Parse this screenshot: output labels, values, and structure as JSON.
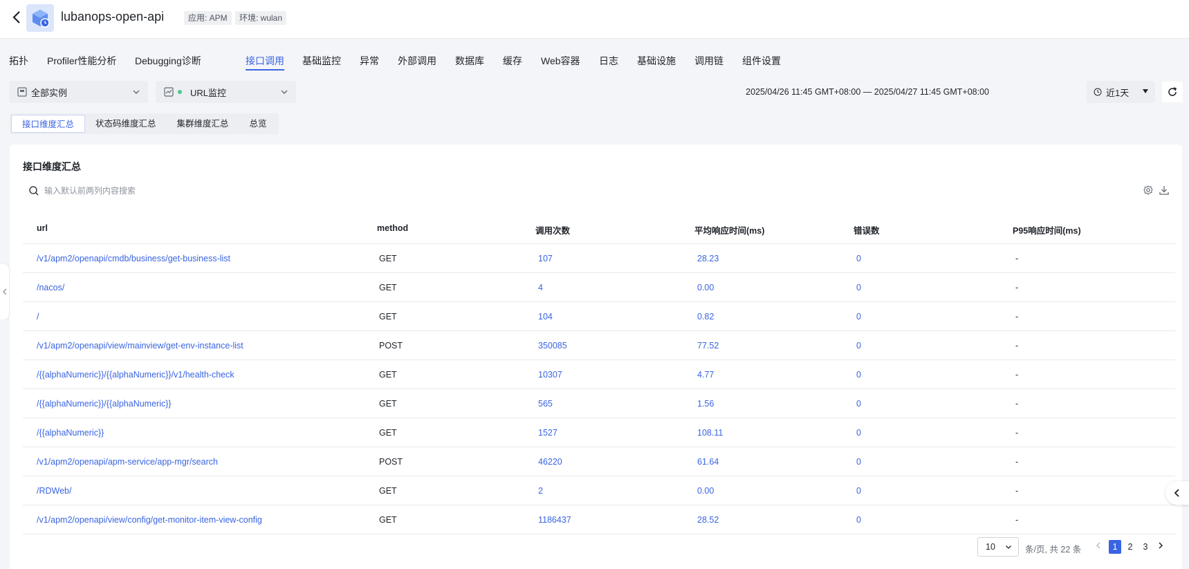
{
  "header": {
    "title": "lubanops-open-api",
    "app_tag": "应用: APM",
    "env_tag": "环境: wulan",
    "icons": {
      "back": "back-arrow-icon",
      "logo": "app-cube-icon"
    }
  },
  "main_tabs": [
    {
      "label": "拓扑",
      "active": false
    },
    {
      "label": "Profiler性能分析",
      "active": false
    },
    {
      "label": "Debugging诊断",
      "active": false
    },
    {
      "label": "接口调用",
      "active": true
    },
    {
      "label": "基础监控",
      "active": false
    },
    {
      "label": "异常",
      "active": false
    },
    {
      "label": "外部调用",
      "active": false
    },
    {
      "label": "数据库",
      "active": false
    },
    {
      "label": "缓存",
      "active": false
    },
    {
      "label": "Web容器",
      "active": false
    },
    {
      "label": "日志",
      "active": false
    },
    {
      "label": "基础设施",
      "active": false
    },
    {
      "label": "调用链",
      "active": false
    },
    {
      "label": "组件设置",
      "active": false
    }
  ],
  "filters": {
    "instance_select": "全部实例",
    "monitor_select": "URL监控",
    "time_range": "2025/04/26 11:45 GMT+08:00 — 2025/04/27 11:45 GMT+08:00",
    "quick_range": "近1天"
  },
  "sub_tabs": [
    {
      "label": "接口维度汇总",
      "active": true
    },
    {
      "label": "状态码维度汇总",
      "active": false
    },
    {
      "label": "集群维度汇总",
      "active": false
    },
    {
      "label": "总览",
      "active": false
    }
  ],
  "card": {
    "title": "接口维度汇总",
    "search_placeholder": "输入默认前两列内容搜索"
  },
  "table": {
    "headers": [
      "url",
      "method",
      "调用次数",
      "平均响应时间(ms)",
      "错误数",
      "P95响应时间(ms)"
    ],
    "rows": [
      {
        "url": "/v1/apm2/openapi/cmdb/business/get-business-list",
        "method": "GET",
        "calls": "107",
        "avg": "28.23",
        "errors": "0",
        "p95": "-"
      },
      {
        "url": "/nacos/",
        "method": "GET",
        "calls": "4",
        "avg": "0.00",
        "errors": "0",
        "p95": "-"
      },
      {
        "url": "/",
        "method": "GET",
        "calls": "104",
        "avg": "0.82",
        "errors": "0",
        "p95": "-"
      },
      {
        "url": "/v1/apm2/openapi/view/mainview/get-env-instance-list",
        "method": "POST",
        "calls": "350085",
        "avg": "77.52",
        "errors": "0",
        "p95": "-"
      },
      {
        "url": "/{{alphaNumeric}}/{{alphaNumeric}}/v1/health-check",
        "method": "GET",
        "calls": "10307",
        "avg": "4.77",
        "errors": "0",
        "p95": "-"
      },
      {
        "url": "/{{alphaNumeric}}/{{alphaNumeric}}",
        "method": "GET",
        "calls": "565",
        "avg": "1.56",
        "errors": "0",
        "p95": "-"
      },
      {
        "url": "/{{alphaNumeric}}",
        "method": "GET",
        "calls": "1527",
        "avg": "108.11",
        "errors": "0",
        "p95": "-"
      },
      {
        "url": "/v1/apm2/openapi/apm-service/app-mgr/search",
        "method": "POST",
        "calls": "46220",
        "avg": "61.64",
        "errors": "0",
        "p95": "-"
      },
      {
        "url": "/RDWeb/",
        "method": "GET",
        "calls": "2",
        "avg": "0.00",
        "errors": "0",
        "p95": "-"
      },
      {
        "url": "/v1/apm2/openapi/view/config/get-monitor-item-view-config",
        "method": "GET",
        "calls": "1186437",
        "avg": "28.52",
        "errors": "0",
        "p95": "-"
      }
    ]
  },
  "pagination": {
    "page_size": "10",
    "total_text": "条/页, 共 22 条",
    "pages": [
      "1",
      "2",
      "3"
    ],
    "current": "1"
  },
  "colors": {
    "accent": "#3964e2",
    "background": "#f4f5f8",
    "status_dot": "#4fca8a"
  }
}
